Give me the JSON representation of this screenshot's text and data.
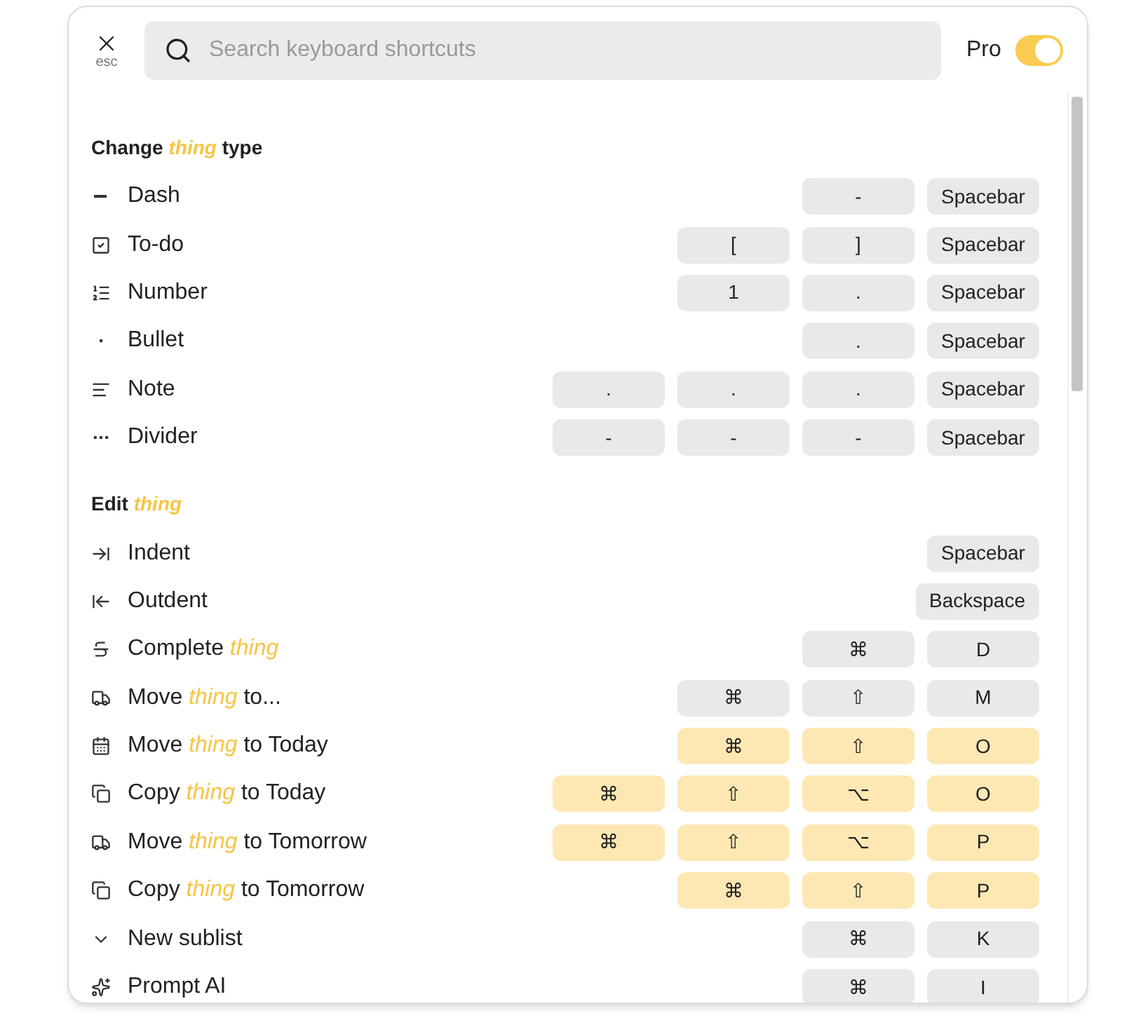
{
  "close": {
    "hint": "esc"
  },
  "search": {
    "placeholder": "Search keyboard shortcuts"
  },
  "pro_toggle": {
    "label": "Pro",
    "on": true
  },
  "sections": [
    {
      "title": "Change *thing* type",
      "rows": [
        {
          "label": "Dash",
          "pro": false,
          "keys": [
            "-",
            "Spacebar"
          ]
        },
        {
          "label": "To-do",
          "pro": false,
          "keys": [
            "[",
            "]",
            "Spacebar"
          ]
        },
        {
          "label": "Number",
          "pro": false,
          "keys": [
            "1",
            ".",
            "Spacebar"
          ]
        },
        {
          "label": "Bullet",
          "pro": false,
          "keys": [
            ".",
            "Spacebar"
          ]
        },
        {
          "label": "Note",
          "pro": false,
          "keys": [
            ".",
            ".",
            ".",
            "Spacebar"
          ]
        },
        {
          "label": "Divider",
          "pro": false,
          "keys": [
            "-",
            "-",
            "-",
            "Spacebar"
          ]
        }
      ]
    },
    {
      "title": "Edit *thing*",
      "rows": [
        {
          "label": "Indent",
          "pro": false,
          "keys": [
            "Spacebar"
          ]
        },
        {
          "label": "Outdent",
          "pro": false,
          "keys": [
            "Backspace"
          ]
        },
        {
          "label": "Complete *thing*",
          "pro": false,
          "keys": [
            "⌘",
            "D"
          ]
        },
        {
          "label": "Move *thing* to...",
          "pro": false,
          "keys": [
            "⌘",
            "⇧",
            "M"
          ]
        },
        {
          "label": "Move *thing* to Today",
          "pro": true,
          "keys": [
            "⌘",
            "⇧",
            "O"
          ]
        },
        {
          "label": "Copy *thing* to Today",
          "pro": true,
          "keys": [
            "⌘",
            "⇧",
            "⌥",
            "O"
          ]
        },
        {
          "label": "Move *thing* to Tomorrow",
          "pro": true,
          "keys": [
            "⌘",
            "⇧",
            "⌥",
            "P"
          ]
        },
        {
          "label": "Copy *thing* to Tomorrow",
          "pro": true,
          "keys": [
            "⌘",
            "⇧",
            "P"
          ]
        },
        {
          "label": "New sublist",
          "pro": false,
          "keys": [
            "⌘",
            "K"
          ]
        },
        {
          "label": "Prompt AI",
          "pro": false,
          "keys": [
            "⌘",
            "I"
          ]
        }
      ]
    }
  ]
}
